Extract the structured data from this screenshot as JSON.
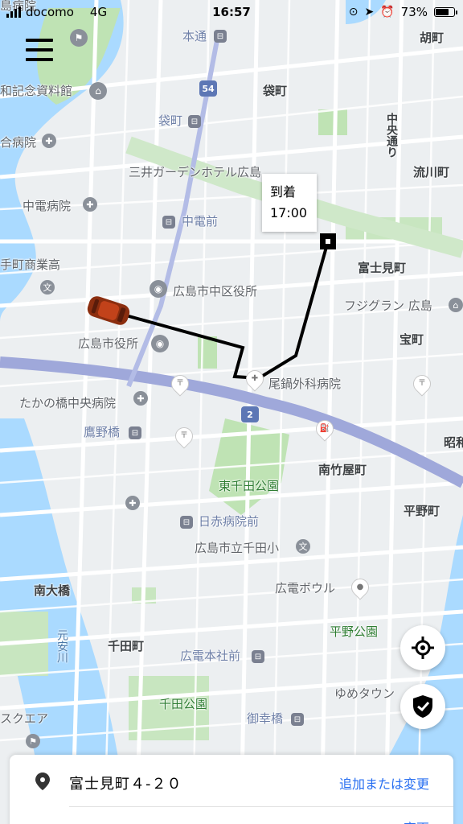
{
  "status_bar": {
    "carrier": "docomo",
    "network": "4G",
    "time": "16:57",
    "battery": "73%",
    "battery_level": 0.73
  },
  "eta": {
    "label": "到着",
    "time": "17:00"
  },
  "destination": {
    "address": "富士見町４-２０",
    "action": "追加または変更"
  },
  "second_row": {
    "action": "変更"
  },
  "map_labels": [
    {
      "id": "hiroshima-hospital-top",
      "text": "島病院"
    },
    {
      "id": "motodori",
      "text": "本通"
    },
    {
      "id": "ebisucho",
      "text": "胡町"
    },
    {
      "id": "peace-memorial",
      "text": "和記念資料館"
    },
    {
      "id": "fukuromachi-area",
      "text": "袋町"
    },
    {
      "id": "fukuromachi-stop",
      "text": "袋町"
    },
    {
      "id": "hospital-left",
      "text": "合病院"
    },
    {
      "id": "chuo-dori",
      "text": "中央通り"
    },
    {
      "id": "nagarekawa",
      "text": "流川町"
    },
    {
      "id": "mitsui-garden",
      "text": "三井ガーデンホテル広島"
    },
    {
      "id": "chuden-hospital",
      "text": "中電病院"
    },
    {
      "id": "chudenmae",
      "text": "中電前"
    },
    {
      "id": "fujimicho",
      "text": "富士見町"
    },
    {
      "id": "commercial-high",
      "text": "手町商業高"
    },
    {
      "id": "naka-ward-office",
      "text": "広島市中区役所"
    },
    {
      "id": "fujigrand",
      "text": "フジグラン 広島"
    },
    {
      "id": "city-hall",
      "text": "広島市役所"
    },
    {
      "id": "takaramachi",
      "text": "宝町"
    },
    {
      "id": "onabe-clinic",
      "text": "尾鍋外科病院"
    },
    {
      "id": "takanobashi-hospital",
      "text": "たかの橋中央病院"
    },
    {
      "id": "takanobashi",
      "text": "鷹野橋"
    },
    {
      "id": "showamachi",
      "text": "昭和"
    },
    {
      "id": "minamitakeyacho",
      "text": "南竹屋町"
    },
    {
      "id": "higashisenda-park",
      "text": "東千田公園"
    },
    {
      "id": "hiranomachi",
      "text": "平野町"
    },
    {
      "id": "nisseki-byoinmae",
      "text": "日赤病院前"
    },
    {
      "id": "senda-elementary",
      "text": "広島市立千田小"
    },
    {
      "id": "hiroden-bowl",
      "text": "広電ボウル"
    },
    {
      "id": "minamiohashi",
      "text": "南大橋"
    },
    {
      "id": "hirano-park",
      "text": "平野公園"
    },
    {
      "id": "motoyasugawa",
      "text": "元安川"
    },
    {
      "id": "sendamachi",
      "text": "千田町"
    },
    {
      "id": "hiroden-honsha",
      "text": "広電本社前"
    },
    {
      "id": "youme-town",
      "text": "ゆめタウン"
    },
    {
      "id": "senda-park",
      "text": "千田公園"
    },
    {
      "id": "miyukibashi",
      "text": "御幸橋"
    },
    {
      "id": "square",
      "text": "スクエア"
    },
    {
      "id": "route-54",
      "text": "54"
    },
    {
      "id": "route-2",
      "text": "2"
    }
  ],
  "colors": {
    "map_bg": "#eceff1",
    "water": "#aadaff",
    "park": "#c8e6c0",
    "highway": "#9fa8da",
    "link_blue": "#276ef1"
  },
  "icons": {
    "menu": "hamburger-menu-icon",
    "locate": "crosshair-icon",
    "safety": "shield-check-icon",
    "pin": "location-pin-icon"
  }
}
